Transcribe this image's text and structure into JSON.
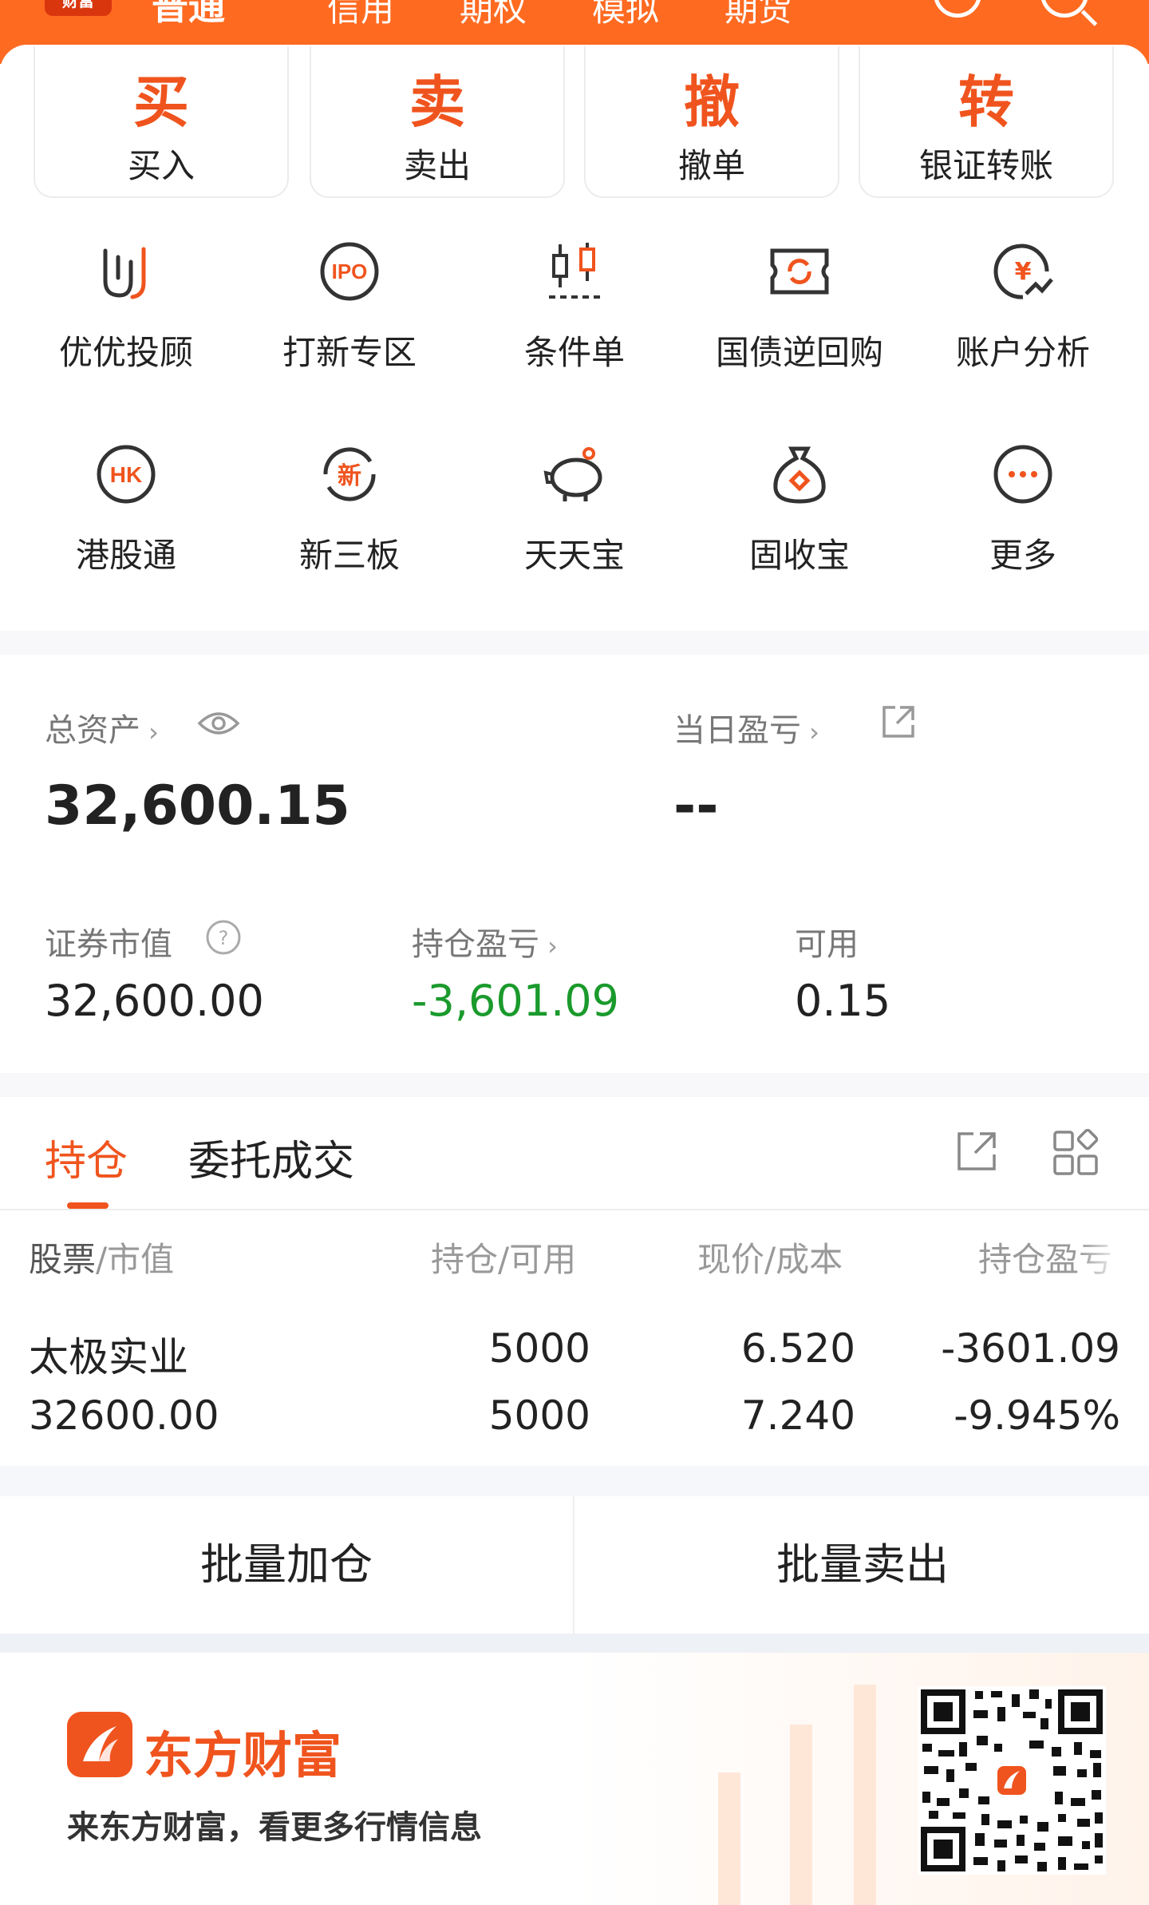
{
  "header": {
    "brand_badge": "财富",
    "tabs": [
      "普通",
      "信用",
      "期权",
      "模拟",
      "期货"
    ],
    "icons": [
      "user-circle-icon",
      "search-icon"
    ]
  },
  "trade_buttons": [
    {
      "big": "买",
      "label": "买入"
    },
    {
      "big": "卖",
      "label": "卖出"
    },
    {
      "big": "撤",
      "label": "撤单"
    },
    {
      "big": "转",
      "label": "银证转账"
    }
  ],
  "grid_row1": [
    {
      "label": "优优投顾",
      "icon": "youyou-icon"
    },
    {
      "label": "打新专区",
      "icon": "ipo-icon"
    },
    {
      "label": "条件单",
      "icon": "candlestick-icon"
    },
    {
      "label": "国债逆回购",
      "icon": "repo-icon"
    },
    {
      "label": "账户分析",
      "icon": "yen-chart-icon"
    }
  ],
  "grid_row2": [
    {
      "label": "港股通",
      "icon": "hk-icon"
    },
    {
      "label": "新三板",
      "icon": "new-board-icon"
    },
    {
      "label": "天天宝",
      "icon": "piggy-bank-icon"
    },
    {
      "label": "固收宝",
      "icon": "money-bag-icon"
    },
    {
      "label": "更多",
      "icon": "more-icon"
    }
  ],
  "assets": {
    "total_label": "总资产",
    "total_value": "32,600.15",
    "daily_pl_label": "当日盈亏",
    "daily_pl_value": "--",
    "market_value_label": "证券市值",
    "market_value": "32,600.00",
    "position_pl_label": "持仓盈亏",
    "position_pl_value": "-3,601.09",
    "available_label": "可用",
    "available_value": "0.15"
  },
  "tabs": {
    "positions": "持仓",
    "orders": "委托成交"
  },
  "table": {
    "headers": {
      "stock_a": "股票",
      "stock_b": "/市值",
      "qty": "持仓/可用",
      "price": "现价/成本",
      "pl": "持仓盈亏"
    },
    "rows": [
      {
        "name": "太极实业",
        "market_value": "32600.00",
        "holding": "5000",
        "available": "5000",
        "price": "6.520",
        "cost": "7.240",
        "pl": "-3601.09",
        "pl_pct": "-9.945%"
      }
    ]
  },
  "bulk": {
    "add": "批量加仓",
    "sell": "批量卖出"
  },
  "promo": {
    "brand": "东方财富",
    "slogan": "来东方财富，看更多行情信息"
  },
  "colors": {
    "accent": "#f0541e",
    "header": "#ff6a21",
    "loss_green": "#1a9a2c"
  }
}
